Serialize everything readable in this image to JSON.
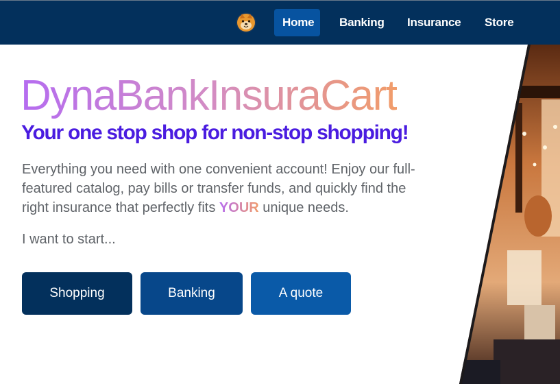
{
  "nav": {
    "logo_icon": "shiba-dog-face-icon",
    "links": [
      {
        "label": "Home",
        "active": true
      },
      {
        "label": "Banking",
        "active": false
      },
      {
        "label": "Insurance",
        "active": false
      },
      {
        "label": "Store",
        "active": false
      }
    ]
  },
  "hero": {
    "title": "DynaBankInsuraCart",
    "tagline": "Your one stop shop for non-stop shopping!",
    "description_before": "Everything you need with one convenient account! Enjoy our full-featured catalog, pay bills or transfer funds, and quickly find the right insurance that perfectly fits ",
    "description_highlight": "YOUR",
    "description_after": " unique needs.",
    "start_prompt": "I want to start...",
    "buttons": [
      "Shopping",
      "Banking",
      "A quote"
    ],
    "image_subject": "storefront-photo"
  },
  "colors": {
    "nav_bg": "#03305c",
    "nav_active": "#0753a0",
    "tagline": "#4a1ce0",
    "gradient_start": "#b56cf0",
    "gradient_end": "#f19c6a"
  }
}
